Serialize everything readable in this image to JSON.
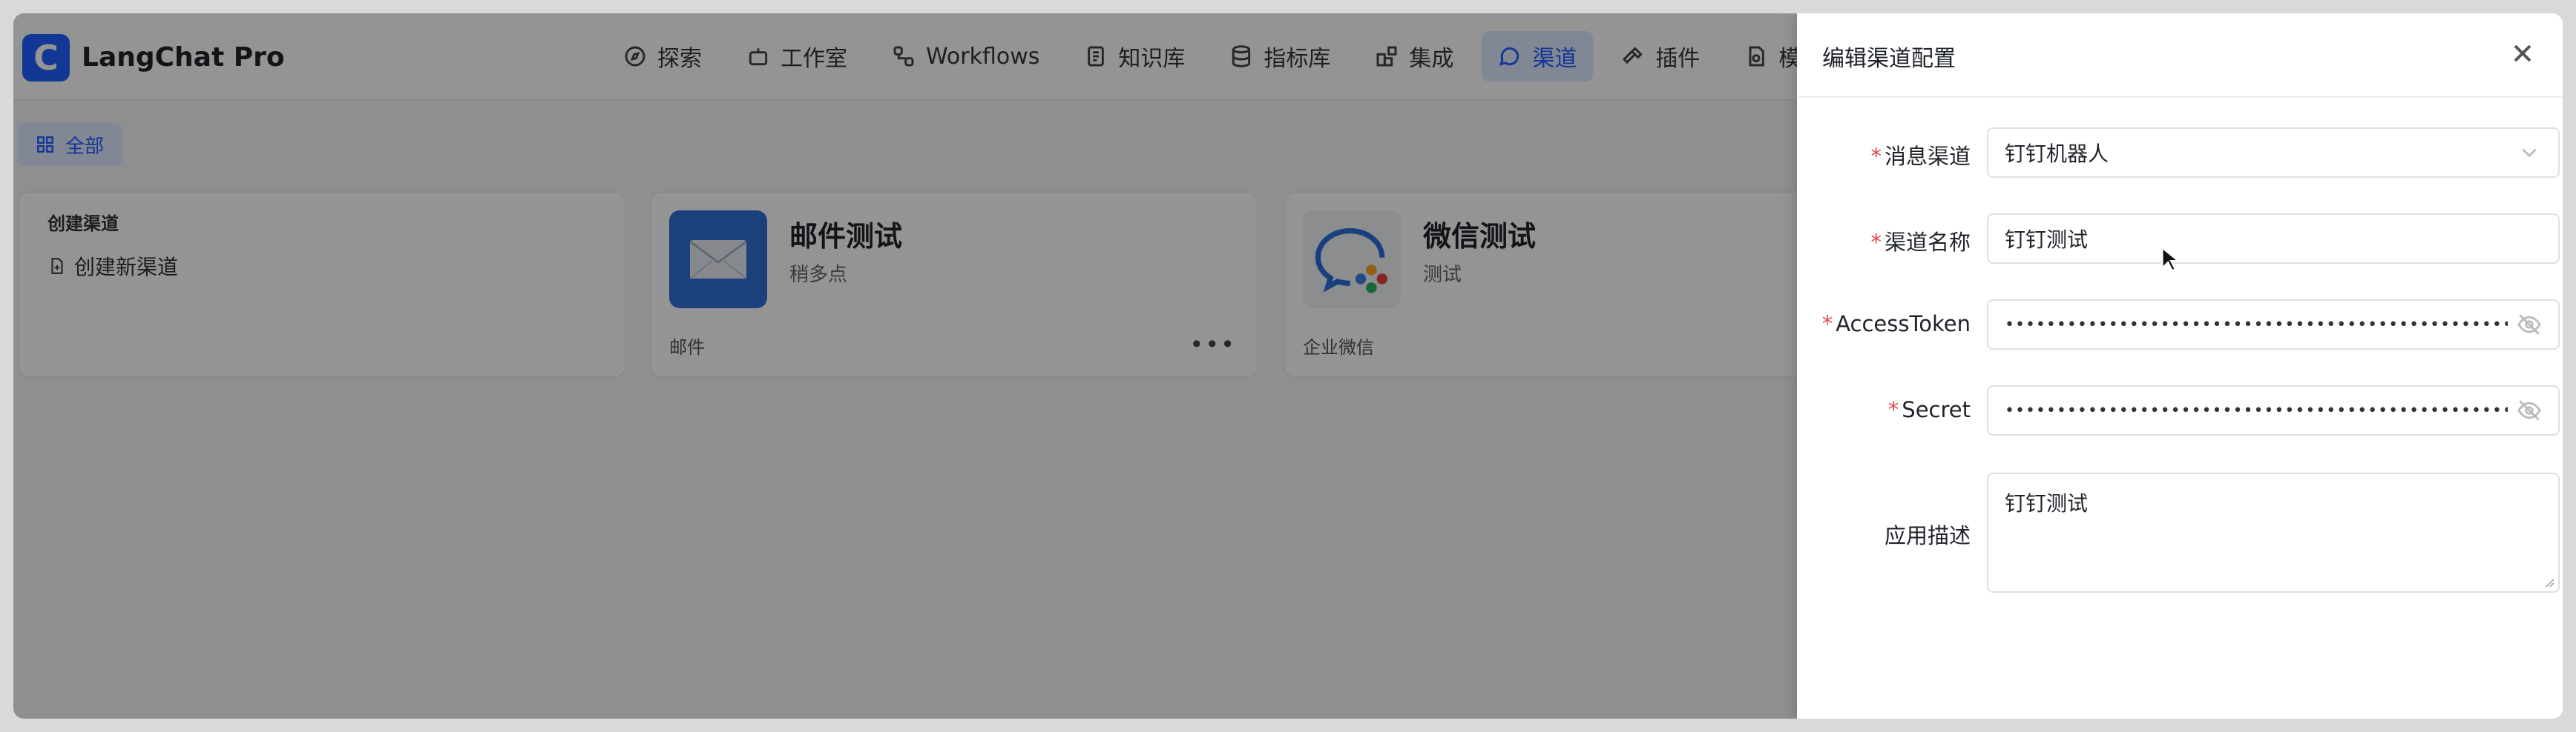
{
  "app": {
    "logo_letter": "C",
    "title": "LangChat Pro"
  },
  "nav": [
    {
      "label": "探索",
      "icon": "compass-icon"
    },
    {
      "label": "工作室",
      "icon": "bot-icon"
    },
    {
      "label": "Workflows",
      "icon": "workflow-icon"
    },
    {
      "label": "知识库",
      "icon": "book-icon"
    },
    {
      "label": "指标库",
      "icon": "database-icon"
    },
    {
      "label": "集成",
      "icon": "blocks-icon"
    },
    {
      "label": "渠道",
      "icon": "chat-icon",
      "active": true
    },
    {
      "label": "插件",
      "icon": "hammer-icon"
    },
    {
      "label": "模型",
      "icon": "model-icon"
    }
  ],
  "filter": {
    "label": "全部"
  },
  "create_card": {
    "title": "创建渠道",
    "link": "创建新渠道"
  },
  "channels": [
    {
      "name": "邮件测试",
      "desc": "稍多点",
      "type": "邮件",
      "more": "•••"
    },
    {
      "name": "微信测试",
      "desc": "测试",
      "type": "企业微信"
    }
  ],
  "drawer": {
    "title": "编辑渠道配置",
    "fields": {
      "channel": {
        "label": "消息渠道",
        "value": "钉钉机器人"
      },
      "name": {
        "label": "渠道名称",
        "value": "钉钉测试"
      },
      "token": {
        "label": "AccessToken",
        "masked": "••••••••••••••••••••••••••••••••••••••••••••••••••••••••"
      },
      "secret": {
        "label": "Secret",
        "masked": "••••••••••••••••••••••••••••••••••••••••••••••••••••••••"
      },
      "desc": {
        "label": "应用描述",
        "value": "钉钉测试"
      }
    }
  },
  "colors": {
    "accent": "#1f5fff",
    "required": "#e5484d"
  }
}
